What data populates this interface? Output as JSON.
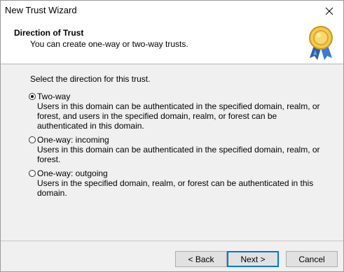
{
  "window": {
    "title": "New Trust Wizard"
  },
  "header": {
    "title": "Direction of Trust",
    "subtitle": "You can create one-way or two-way trusts.",
    "icon": "award-medal-icon"
  },
  "body": {
    "prompt": "Select the direction for this trust.",
    "options": [
      {
        "label": "Two-way",
        "checked": true,
        "description": "Users in this domain can be authenticated in the specified domain, realm, or forest, and users in the specified domain, realm, or forest can be authenticated in this domain."
      },
      {
        "label": "One-way: incoming",
        "checked": false,
        "description": "Users in this domain can be authenticated in the specified domain, realm, or forest."
      },
      {
        "label": "One-way: outgoing",
        "checked": false,
        "description": "Users in the specified domain, realm, or forest can be authenticated in this domain."
      }
    ]
  },
  "buttons": {
    "back": "< Back",
    "next": "Next >",
    "cancel": "Cancel"
  },
  "colors": {
    "accent": "#0078d7",
    "medal_gold": "#e8b923",
    "ribbon_blue": "#2a5db0"
  }
}
